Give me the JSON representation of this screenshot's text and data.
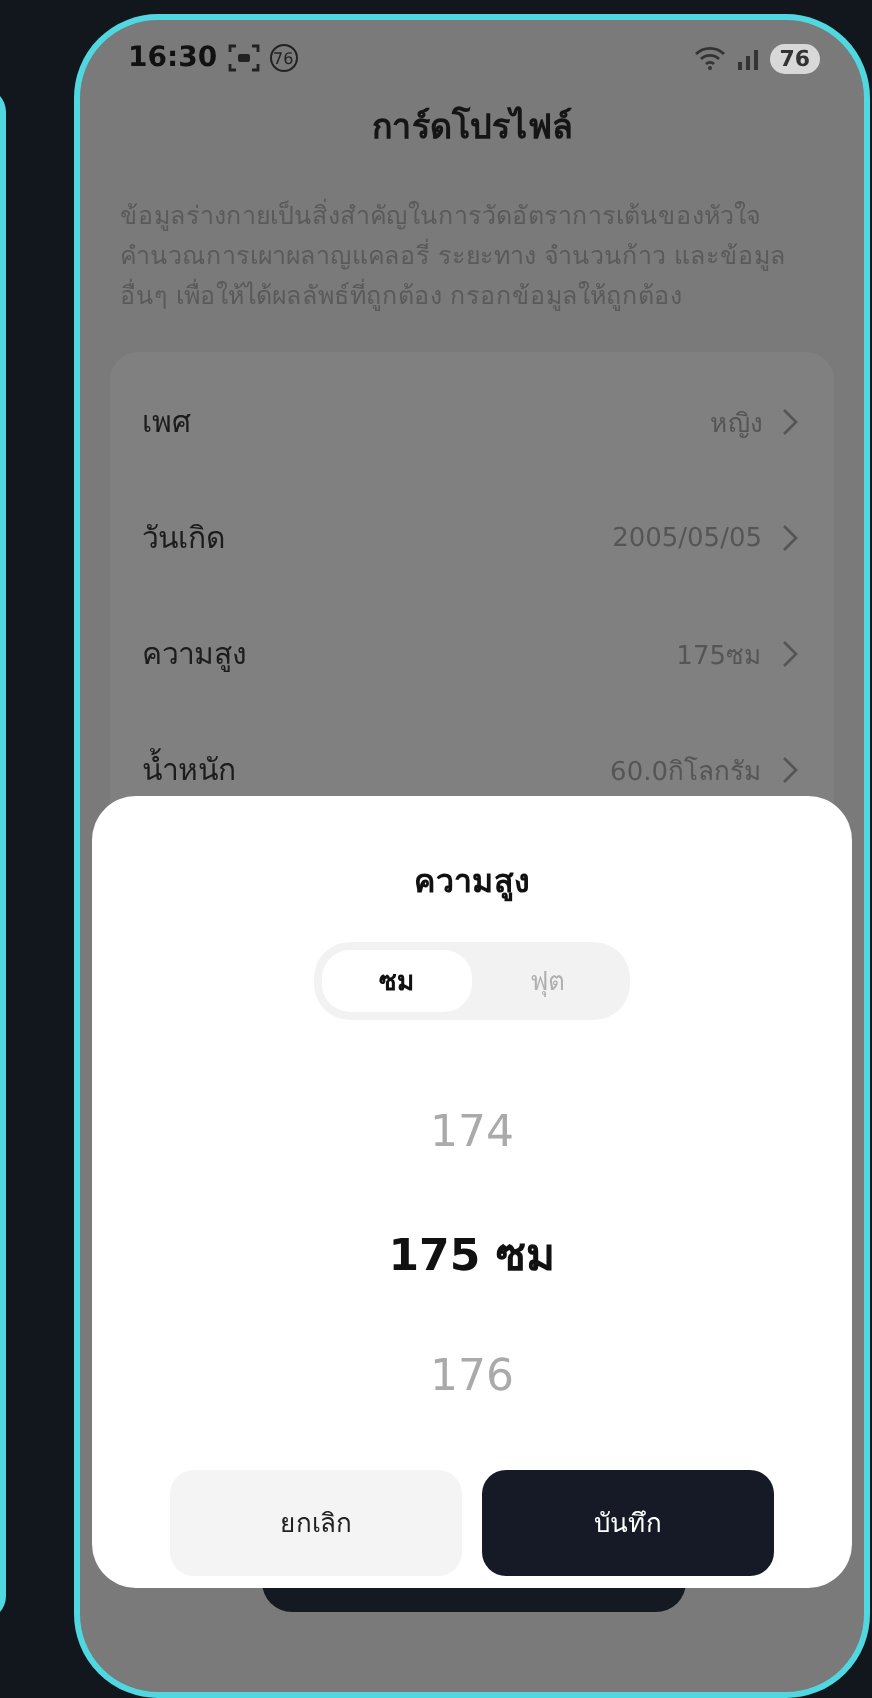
{
  "status_bar": {
    "time": "16:30",
    "notification_badge": "76",
    "battery": "76"
  },
  "title": "การ์ดโปรไฟล์",
  "description": "ข้อมูลร่างกายเป็นสิ่งสำคัญในการวัดอัตราการเต้นของหัวใจ คำนวณการเผาผลาญแคลอรี่ ระยะทาง จำนวนก้าว และข้อมูลอื่นๆ เพื่อให้ได้ผลลัพธ์ที่ถูกต้อง กรอกข้อมูลให้ถูกต้อง",
  "profile_rows": [
    {
      "label": "เพศ",
      "value": "หญิง"
    },
    {
      "label": "วันเกิด",
      "value": "2005/05/05"
    },
    {
      "label": "ความสูง",
      "value": "175ซม"
    },
    {
      "label": "น้ำหนัก",
      "value": "60.0กิโลกรัม"
    }
  ],
  "sheet": {
    "title": "ความสูง",
    "unit_tabs": [
      {
        "label": "ซม",
        "selected": true
      },
      {
        "label": "ฟุต",
        "selected": false
      }
    ],
    "picker_items": [
      {
        "label": "174",
        "selected": false
      },
      {
        "label": "175 ซม",
        "selected": true
      },
      {
        "label": "176",
        "selected": false
      }
    ],
    "buttons": [
      {
        "label": "ยกเลิก",
        "kind": "secondary"
      },
      {
        "label": "บันทึก",
        "kind": "primary"
      }
    ]
  }
}
